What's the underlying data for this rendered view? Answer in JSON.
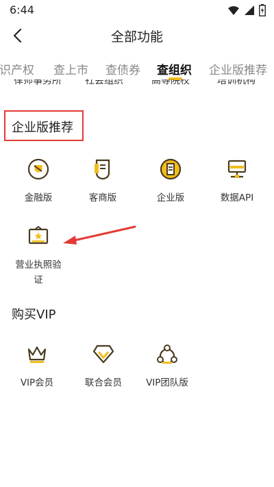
{
  "status": {
    "time": "6:44"
  },
  "header": {
    "title": "全部功能"
  },
  "tabs": [
    {
      "label": "知识产权"
    },
    {
      "label": "查上市"
    },
    {
      "label": "查债券"
    },
    {
      "label": "查组织"
    },
    {
      "label": "企业版推荐"
    }
  ],
  "partial_row": [
    "律师事务所",
    "社会组织",
    "高等院校",
    "培训机构"
  ],
  "enterprise": {
    "title": "企业版推荐",
    "items": [
      {
        "label": "金融版",
        "icon": "finance-shield-icon"
      },
      {
        "label": "客商版",
        "icon": "merchant-document-icon"
      },
      {
        "label": "企业版",
        "icon": "enterprise-badge-icon"
      },
      {
        "label": "数据API",
        "icon": "server-api-icon"
      },
      {
        "label": "营业执照验证",
        "label_line1": "营业执照验",
        "label_line2": "证",
        "icon": "license-frame-icon"
      }
    ]
  },
  "vip": {
    "title": "购买VIP",
    "items": [
      {
        "label": "VIP会员",
        "icon": "crown-icon"
      },
      {
        "label": "联合会员",
        "icon": "diamond-icon"
      },
      {
        "label": "VIP团队版",
        "icon": "team-icon"
      }
    ]
  },
  "colors": {
    "accent": "#f2bd1a",
    "icon_stroke": "#4a3a1e",
    "highlight": "#e53935"
  }
}
